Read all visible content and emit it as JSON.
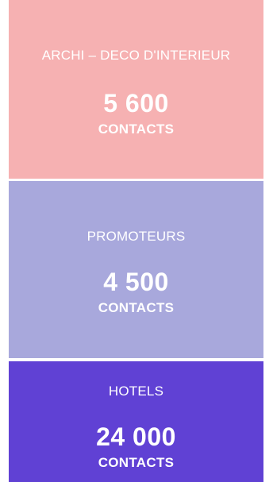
{
  "cards": [
    {
      "category": "ARCHI – DECO D'INTERIEUR",
      "count": "5 600",
      "unit": "CONTACTS",
      "color": "#f6b1b2"
    },
    {
      "category": "PROMOTEURS",
      "count": "4 500",
      "unit": "CONTACTS",
      "color": "#a8a8dc"
    },
    {
      "category": "HOTELS",
      "count": "24 000",
      "unit": "CONTACTS",
      "color": "#6041d4"
    }
  ]
}
